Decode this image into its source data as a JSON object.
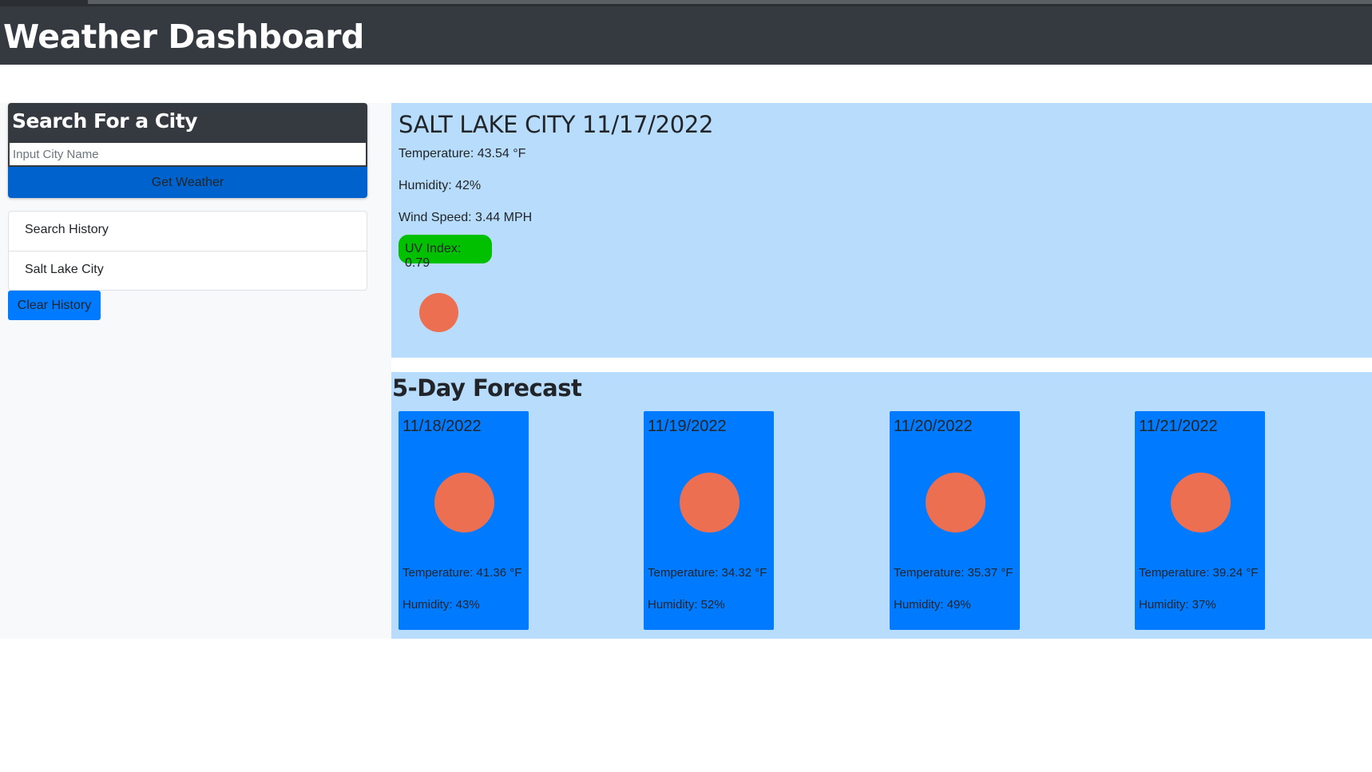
{
  "header": {
    "title": "Weather Dashboard"
  },
  "search": {
    "title": "Search For a City",
    "placeholder": "Input City Name",
    "value": "",
    "button_label": "Get Weather"
  },
  "history": {
    "items": [
      {
        "label": "Search History"
      },
      {
        "label": "Salt Lake City"
      }
    ],
    "clear_label": "Clear History"
  },
  "current": {
    "city_date": "SALT LAKE CITY 11/17/2022",
    "temperature": "Temperature: 43.54 °F",
    "humidity": "Humidity: 42%",
    "wind": "Wind Speed: 3.44 MPH",
    "uv": "UV Index: 0.79",
    "icon": "weather-icon"
  },
  "forecast": {
    "title": "5-Day Forecast",
    "days": [
      {
        "date": "11/18/2022",
        "temperature": "Temperature: 41.36 °F",
        "humidity": "Humidity: 43%",
        "icon": "weather-icon"
      },
      {
        "date": "11/19/2022",
        "temperature": "Temperature: 34.32 °F",
        "humidity": "Humidity: 52%",
        "icon": "weather-icon"
      },
      {
        "date": "11/20/2022",
        "temperature": "Temperature: 35.37 °F",
        "humidity": "Humidity: 49%",
        "icon": "weather-icon"
      },
      {
        "date": "11/21/2022",
        "temperature": "Temperature: 39.24 °F",
        "humidity": "Humidity: 37%",
        "icon": "weather-icon"
      }
    ]
  },
  "colors": {
    "header_bg": "#343a40",
    "primary": "#007bff",
    "get_weather_bg": "#0062cc",
    "panel_bg": "#b8dcfb",
    "uv_low": "#00c000",
    "weather_icon": "#ec6f51"
  }
}
